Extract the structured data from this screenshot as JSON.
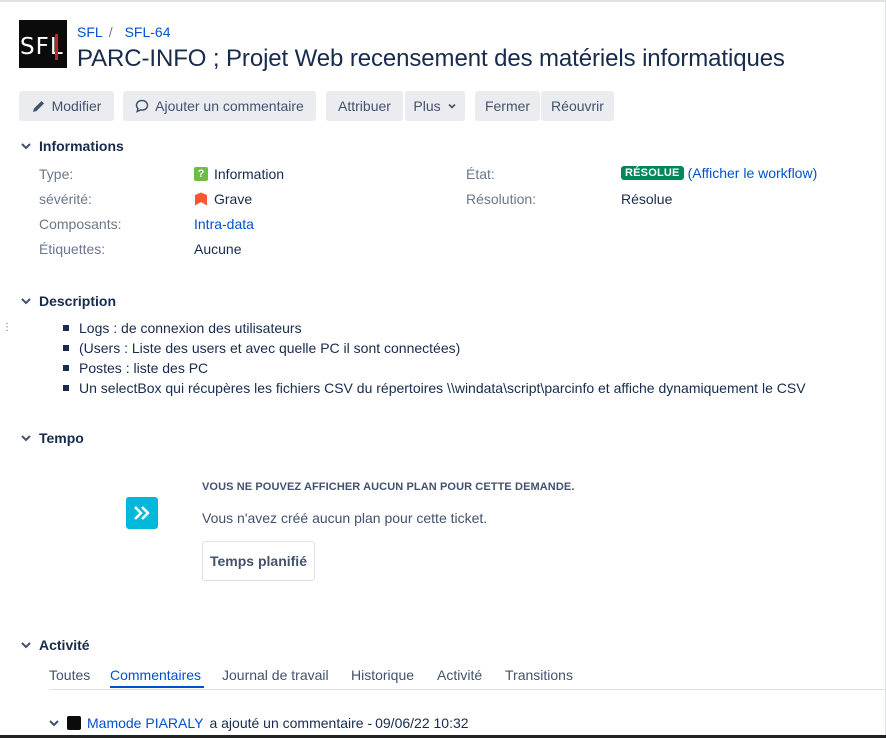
{
  "breadcrumb": {
    "project": "SFL",
    "issue_key": "SFL-64"
  },
  "logo": {
    "text": "SFL"
  },
  "issue": {
    "title": "PARC-INFO ; Projet Web recensement des matériels informatiques"
  },
  "toolbar": {
    "edit": "Modifier",
    "comment": "Ajouter un commentaire",
    "assign": "Attribuer",
    "more": "Plus",
    "close": "Fermer",
    "reopen": "Réouvrir"
  },
  "details": {
    "heading": "Informations",
    "type_label": "Type:",
    "type_value": "Information",
    "type_icon_glyph": "?",
    "severity_label": "sévérité:",
    "severity_value": "Grave",
    "components_label": "Composants:",
    "components_value": "Intra-data",
    "labels_label": "Étiquettes:",
    "labels_value": "Aucune",
    "status_label": "État:",
    "status_value": "RÉSOLUE",
    "workflow_link": "(Afficher le workflow)",
    "resolution_label": "Résolution:",
    "resolution_value": "Résolue"
  },
  "description": {
    "heading": "Description",
    "items": [
      "Logs : de connexion des utilisateurs",
      "(Users : Liste des users et avec quelle PC il sont connectées)",
      "Postes : liste des PC",
      "Un selectBox qui récupères les fichiers CSV du répertoires \\\\windata\\script\\parcinfo et affiche dynamiquement le CSV"
    ]
  },
  "tempo": {
    "heading": "Tempo",
    "notice_title": "VOUS NE POUVEZ AFFICHER AUCUN PLAN POUR CETTE DEMANDE.",
    "notice_text": "Vous n'avez créé aucun plan pour cette ticket.",
    "plan_button": "Temps planifié"
  },
  "activity": {
    "heading": "Activité",
    "tabs": [
      "Toutes",
      "Commentaires",
      "Journal de travail",
      "Historique",
      "Activité",
      "Transitions"
    ],
    "active_tab": "Commentaires",
    "comment": {
      "author": "Mamode PIARALY",
      "action": "a ajouté un commentaire -",
      "timestamp": "09/06/22 10:32"
    }
  },
  "colors": {
    "link": "#0052cc",
    "status_resolved": "#00875a",
    "type_information": "#6bbd45",
    "severity_grave": "#ff5630",
    "tempo": "#00b8d9"
  }
}
